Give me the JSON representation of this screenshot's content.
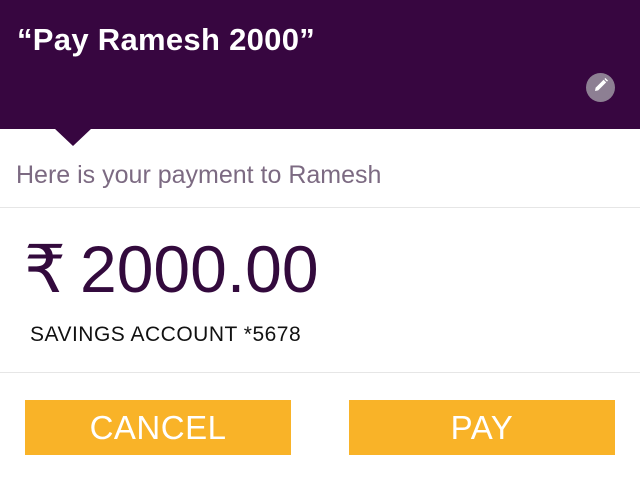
{
  "header": {
    "voice_command": "“Pay Ramesh 2000”",
    "edit_icon": "pencil-icon"
  },
  "confirmation": {
    "message": "Here is your payment to Ramesh",
    "currency_symbol": "₹",
    "amount": "2000.00",
    "account": "SAVINGS ACCOUNT *5678"
  },
  "actions": {
    "cancel_label": "CANCEL",
    "pay_label": "PAY"
  },
  "colors": {
    "header_bg": "#370640",
    "button_bg": "#f9b328",
    "amount_text": "#330a3d"
  }
}
